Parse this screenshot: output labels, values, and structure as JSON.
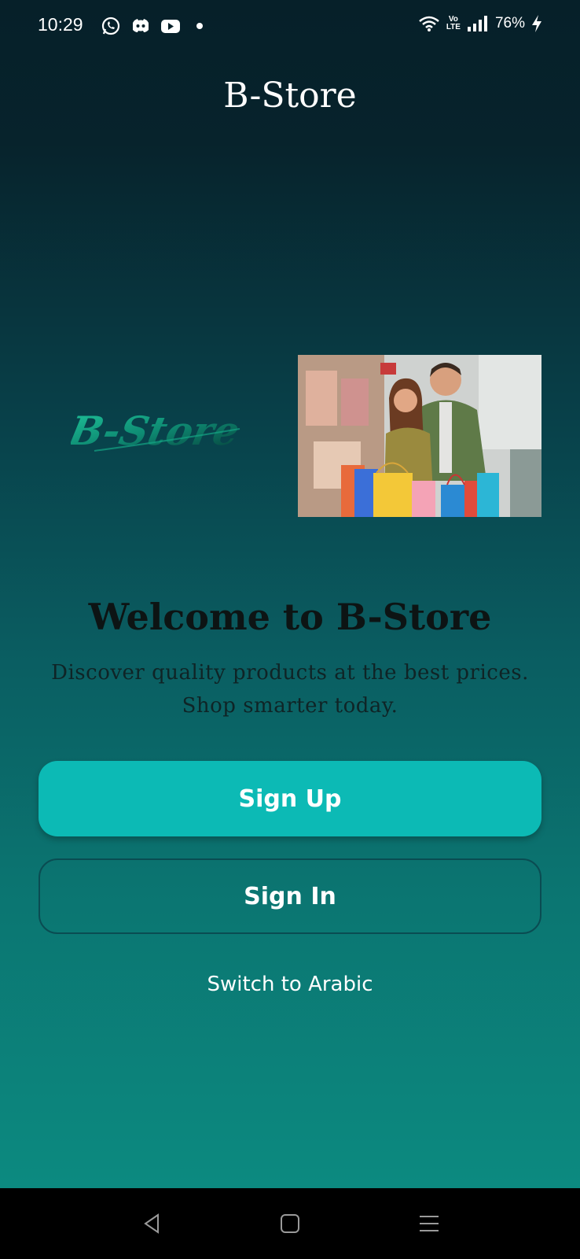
{
  "status_bar": {
    "time": "10:29",
    "notification_icons": [
      "whatsapp-icon",
      "discord-icon",
      "youtube-icon",
      "dot-icon"
    ],
    "volte_top": "Vo",
    "volte_bottom": "LTE",
    "battery": "76%"
  },
  "header": {
    "title": "B-Store"
  },
  "hero": {
    "logo_text": "B-Store",
    "photo_subject": "couple with shopping bags"
  },
  "welcome": {
    "title": "Welcome to B-Store",
    "subtitle_line1": "Discover quality products at the best prices.",
    "subtitle_line2": "Shop smarter today."
  },
  "actions": {
    "sign_up": "Sign Up",
    "sign_in": "Sign In",
    "switch_language": "Switch to Arabic"
  },
  "colors": {
    "primary_button": "#0cbab5",
    "background_top": "#062029",
    "background_bottom": "#0c8a80"
  },
  "nav_bar": {
    "buttons": [
      "back-icon",
      "home-icon",
      "menu-icon"
    ]
  }
}
